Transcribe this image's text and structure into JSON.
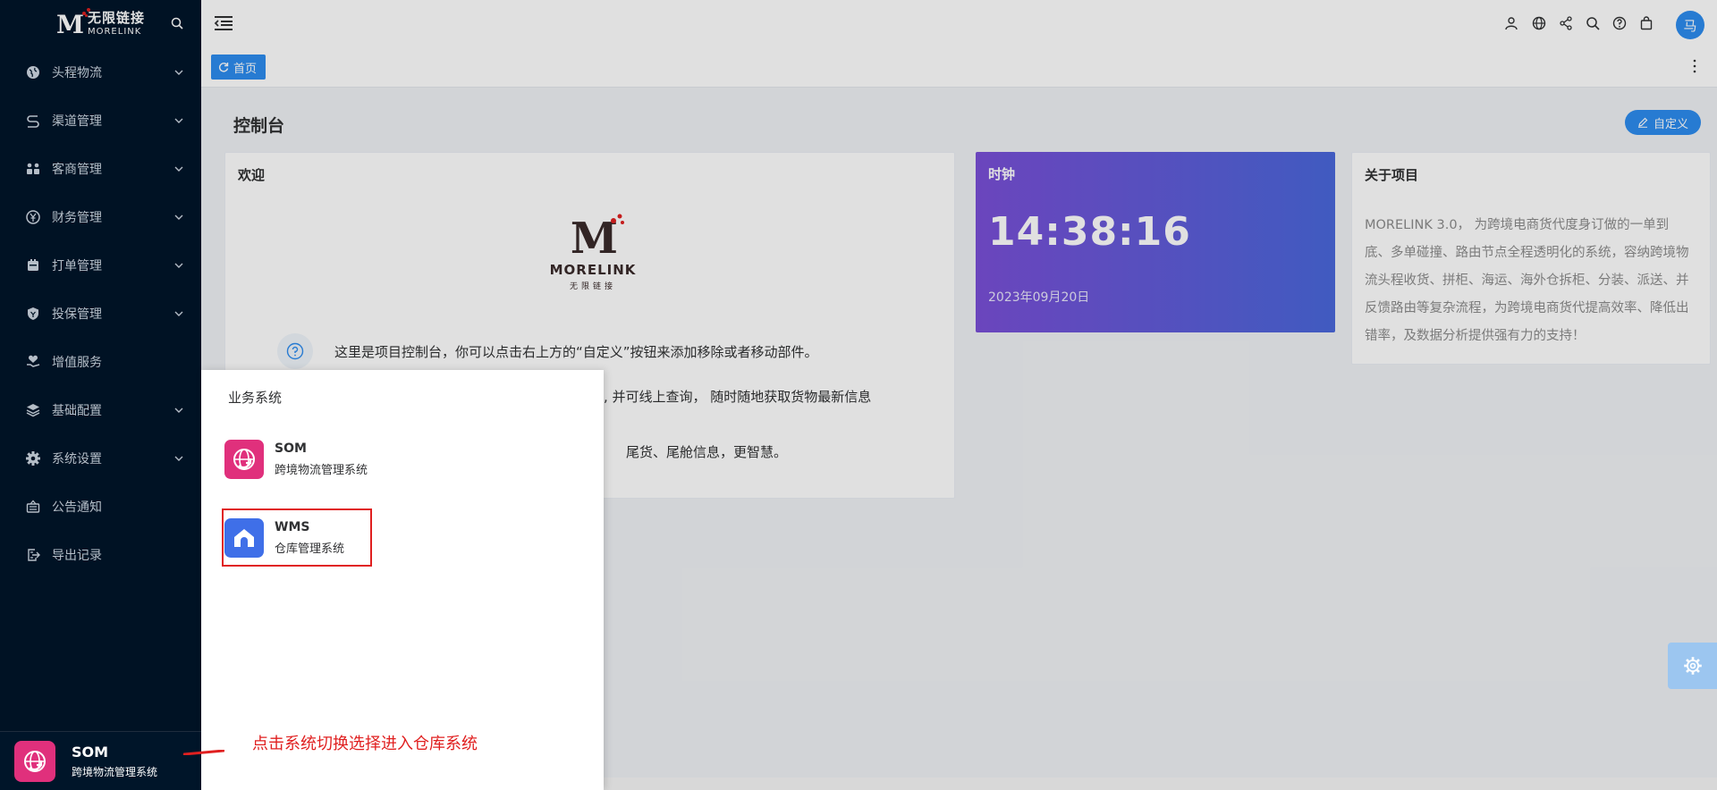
{
  "brand": {
    "name_cn": "无限链接",
    "name_en": "MORELINK"
  },
  "sidebar": {
    "items": [
      {
        "label": "头程物流",
        "icon": "globe-icon",
        "has_children": true
      },
      {
        "label": "渠道管理",
        "icon": "route-icon",
        "has_children": true
      },
      {
        "label": "客商管理",
        "icon": "users-icon",
        "has_children": true
      },
      {
        "label": "财务管理",
        "icon": "yuan-icon",
        "has_children": true
      },
      {
        "label": "打单管理",
        "icon": "printer-icon",
        "has_children": true
      },
      {
        "label": "投保管理",
        "icon": "shield-icon",
        "has_children": true
      },
      {
        "label": "增值服务",
        "icon": "heart-hand-icon",
        "has_children": false
      },
      {
        "label": "基础配置",
        "icon": "layers-icon",
        "has_children": true
      },
      {
        "label": "系统设置",
        "icon": "gear-icon",
        "has_children": true
      },
      {
        "label": "公告通知",
        "icon": "notice-icon",
        "has_children": false
      },
      {
        "label": "导出记录",
        "icon": "export-icon",
        "has_children": false
      }
    ],
    "current_system": {
      "name": "SOM",
      "desc": "跨境物流管理系统"
    }
  },
  "header": {
    "avatar_text": "马",
    "icons": [
      "user-switch-icon",
      "globe-icon",
      "share-icon",
      "search-icon",
      "help-icon",
      "bag-icon"
    ]
  },
  "tags": {
    "home_label": "首页"
  },
  "page": {
    "title": "控制台",
    "customize_label": "自定义"
  },
  "welcome": {
    "title": "欢迎",
    "logo_en": "MORELINK",
    "logo_cn": "无限链接",
    "tip": "这里是项目控制台，你可以点击右上方的“自定义”按钮来添加移除或者移动部件。",
    "line2": "时, 并可线上查询， 随时随地获取货物最新信息",
    "line3": "尾货、尾舱信息，更智慧。"
  },
  "clock": {
    "title": "时钟",
    "time": "14:38:16",
    "date": "2023年09月20日"
  },
  "about": {
    "title": "关于项目",
    "text": "MORELINK 3.0， 为跨境电商货代度身订做的一单到底、多单碰撞、路由节点全程透明化的系统，容纳跨境物流头程收货、拼柜、海运、海外仓拆柜、分装、派送、并反馈路由等复杂流程，为跨境电商货代提高效率、降低出错率，及数据分析提供强有力的支持！"
  },
  "switch_panel": {
    "title": "业务系统",
    "systems": [
      {
        "name": "SOM",
        "desc": "跨境物流管理系统",
        "color": "#e0307c"
      },
      {
        "name": "WMS",
        "desc": "仓库管理系统",
        "color": "#3f6fe8"
      }
    ]
  },
  "annotation": {
    "text": "点击系统切换选择进入仓库系统"
  },
  "colors": {
    "sidebar_bg": "#001529",
    "primary": "#2d8cf0",
    "annotation": "#e02020"
  }
}
